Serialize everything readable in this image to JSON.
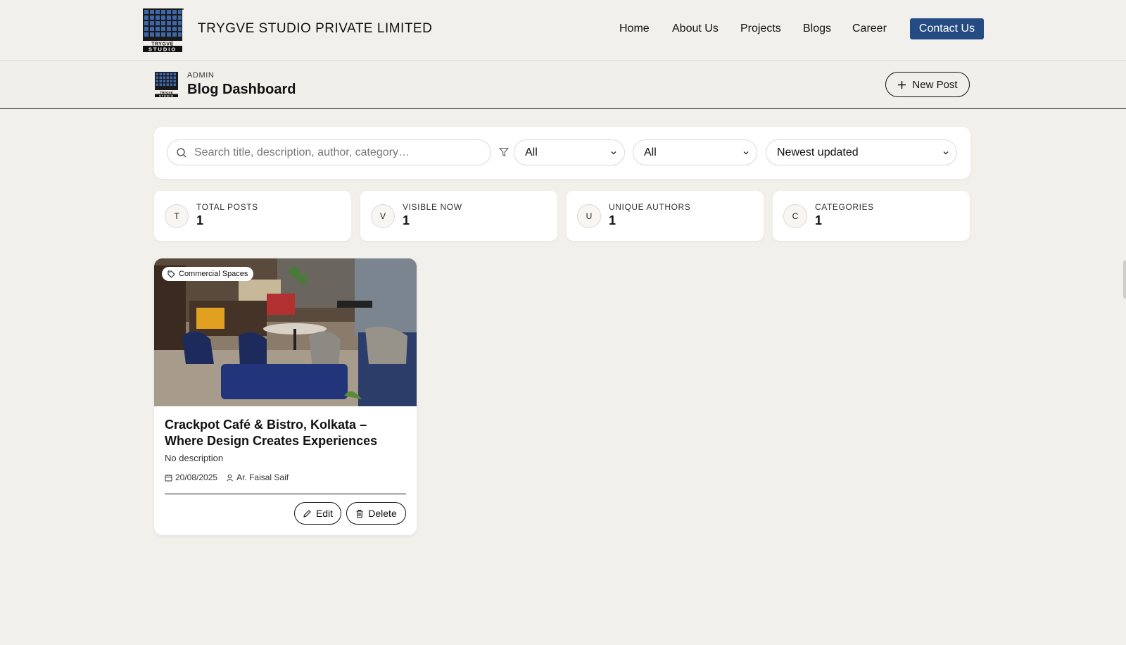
{
  "brand": {
    "name": "TRYGVE STUDIO PRIVATE LIMITED",
    "logo_text": "TRYGVE",
    "logo_subtext": "STUDIO"
  },
  "nav": {
    "items": [
      "Home",
      "About Us",
      "Projects",
      "Blogs",
      "Career"
    ],
    "contact_label": "Contact Us"
  },
  "admin": {
    "kicker": "ADMIN",
    "title": "Blog Dashboard",
    "new_post_label": "New Post"
  },
  "filters": {
    "search_placeholder": "Search title, description, author, category…",
    "status_value": "All",
    "category_value": "All",
    "sort_value": "Newest updated"
  },
  "stats": [
    {
      "initial": "T",
      "label": "TOTAL POSTS",
      "value": "1"
    },
    {
      "initial": "V",
      "label": "VISIBLE NOW",
      "value": "1"
    },
    {
      "initial": "U",
      "label": "UNIQUE AUTHORS",
      "value": "1"
    },
    {
      "initial": "C",
      "label": "CATEGORIES",
      "value": "1"
    }
  ],
  "posts": [
    {
      "category": "Commercial Spaces",
      "title": "Crackpot Café & Bistro, Kolkata – Where Design Creates Experiences",
      "description": "No description",
      "date": "20/08/2025",
      "author": "Ar. Faisal Saif",
      "edit_label": "Edit",
      "delete_label": "Delete"
    }
  ],
  "colors": {
    "accent": "#244b82",
    "background": "#f2f0eb",
    "card": "#ffffff"
  },
  "icons": {
    "search": "search-icon",
    "filter": "filter-icon",
    "plus": "plus-icon",
    "tag": "tag-icon",
    "calendar": "calendar-icon",
    "user": "user-icon",
    "edit": "pencil-icon",
    "delete": "trash-icon"
  }
}
